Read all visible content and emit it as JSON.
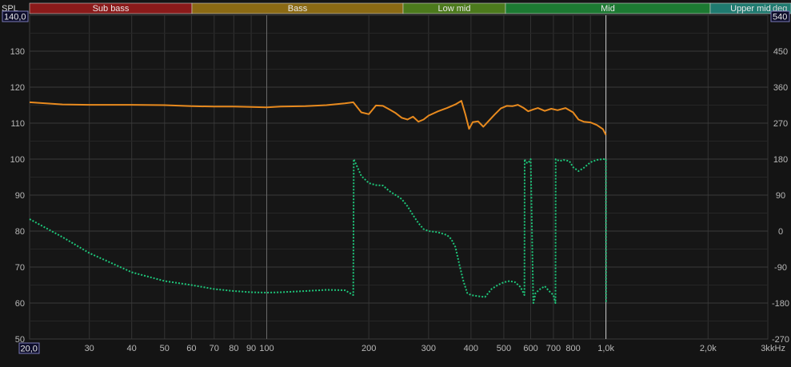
{
  "bands": [
    {
      "label": "Sub bass",
      "color": "#8b1a1a"
    },
    {
      "label": "Bass",
      "color": "#8b6a14"
    },
    {
      "label": "Low mid",
      "color": "#4c7a1c"
    },
    {
      "label": "Mid",
      "color": "#1c7a32"
    },
    {
      "label": "Upper mid",
      "color": "#1f7a70"
    }
  ],
  "left_axis": {
    "title": "SPL",
    "max_label": "140,0",
    "min_label": "50",
    "ticks": [
      "130",
      "120",
      "110",
      "100",
      "90",
      "80",
      "70",
      "60",
      "50"
    ]
  },
  "right_axis": {
    "title": "deg",
    "max_label": "540",
    "ticks": [
      "450",
      "360",
      "270",
      "180",
      "90",
      "0",
      "-90",
      "-180",
      "-270"
    ]
  },
  "x_axis": {
    "min_label": "20,0",
    "unit": "kHz",
    "ticks": [
      "30",
      "40",
      "50",
      "60",
      "70",
      "80",
      "90",
      "100",
      "200",
      "300",
      "400",
      "500",
      "600",
      "700",
      "800",
      "1,0k",
      "2,0k",
      "3k"
    ]
  },
  "chart_data": {
    "type": "line",
    "x_scale": "log",
    "xlim": [
      20,
      3000
    ],
    "ylim": [
      50,
      140
    ],
    "y2lim": [
      -270,
      540
    ],
    "grid": true,
    "cursor_x": 1000,
    "series": [
      {
        "axis": "left",
        "color": "#e88a1e",
        "style": "solid",
        "x": [
          20,
          25,
          30,
          40,
          50,
          60,
          70,
          80,
          90,
          100,
          110,
          130,
          150,
          170,
          180,
          190,
          200,
          210,
          220,
          230,
          240,
          250,
          260,
          270,
          280,
          290,
          300,
          320,
          340,
          360,
          375,
          385,
          395,
          405,
          420,
          435,
          450,
          470,
          490,
          510,
          530,
          550,
          570,
          590,
          610,
          630,
          660,
          690,
          720,
          760,
          800,
          830,
          860,
          900,
          940,
          980,
          1000
        ],
        "y": [
          115.8,
          115.2,
          115.1,
          115.1,
          115.0,
          114.7,
          114.6,
          114.6,
          114.5,
          114.4,
          114.6,
          114.7,
          115.0,
          115.5,
          115.8,
          113.0,
          112.5,
          114.9,
          114.8,
          113.8,
          112.8,
          111.5,
          111.0,
          111.8,
          110.4,
          111.0,
          112.1,
          113.3,
          114.2,
          115.2,
          116.2,
          112.5,
          108.4,
          110.3,
          110.5,
          109.0,
          110.5,
          112.4,
          114.1,
          114.8,
          114.7,
          115.1,
          114.3,
          113.3,
          113.8,
          114.2,
          113.4,
          114.0,
          113.6,
          114.2,
          113.0,
          111.0,
          110.4,
          110.2,
          109.5,
          108.3,
          106.7
        ]
      },
      {
        "axis": "right",
        "color": "#1ec67a",
        "style": "dotted",
        "x": [
          20,
          25,
          30,
          40,
          50,
          60,
          70,
          80,
          90,
          100,
          110,
          130,
          150,
          170,
          180,
          180.5,
          185,
          190,
          200,
          210,
          220,
          230,
          240,
          250,
          260,
          270,
          280,
          290,
          300,
          320,
          340,
          350,
          360,
          370,
          380,
          390,
          400,
          420,
          440,
          460,
          480,
          500,
          520,
          540,
          560,
          575,
          576,
          580,
          590,
          600,
          610,
          611,
          620,
          640,
          660,
          680,
          700,
          710,
          711,
          730,
          750,
          780,
          800,
          830,
          860,
          900,
          940,
          980,
          1000,
          1001
        ],
        "y": [
          30,
          -15,
          -55,
          -103,
          -125,
          -135,
          -145,
          -150,
          -153,
          -154,
          -153,
          -150,
          -147,
          -148,
          -160,
          180,
          160,
          138,
          120,
          115,
          114,
          100,
          90,
          80,
          62,
          40,
          20,
          5,
          0,
          -3,
          -10,
          -20,
          -40,
          -85,
          -125,
          -155,
          -160,
          -163,
          -165,
          -145,
          -135,
          -128,
          -125,
          -128,
          -140,
          -160,
          180,
          172,
          170,
          180,
          -160,
          -180,
          -155,
          -145,
          -138,
          -150,
          -160,
          -180,
          180,
          175,
          178,
          175,
          160,
          150,
          158,
          172,
          178,
          180,
          180,
          -180
        ]
      }
    ]
  }
}
